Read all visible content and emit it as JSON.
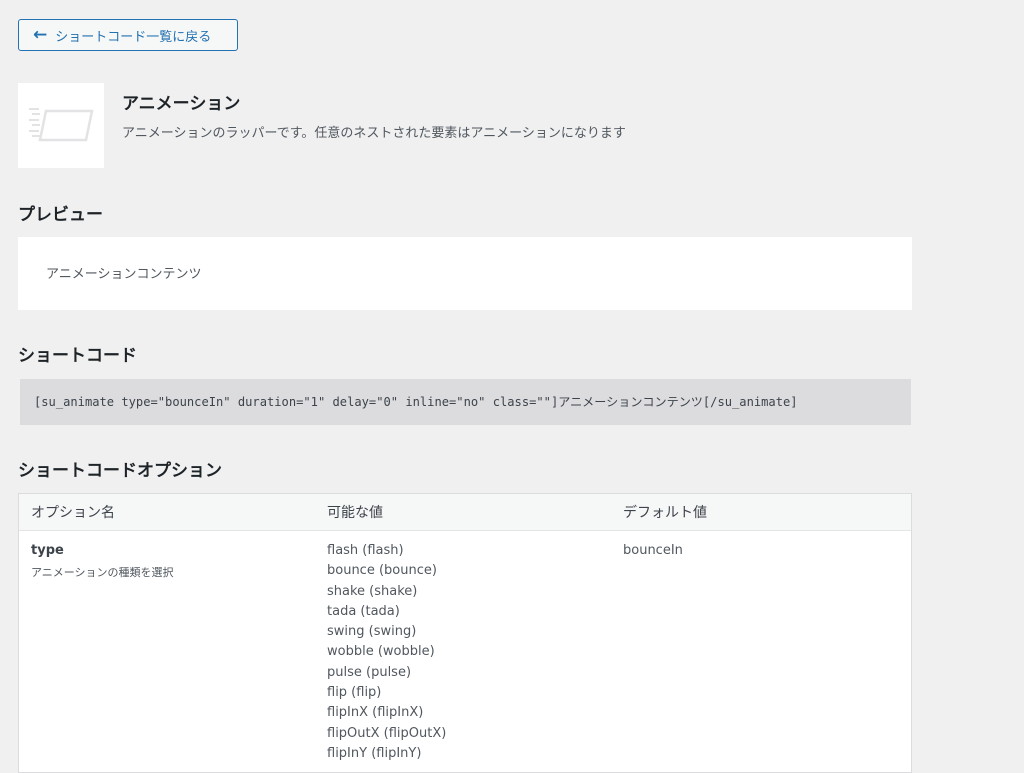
{
  "back_button": {
    "label": "ショートコード一覧に戻る",
    "icon": "arrow-left-icon",
    "color": "#2271b1"
  },
  "shortcode": {
    "title": "アニメーション",
    "description": "アニメーションのラッパーです。任意のネストされた要素はアニメーションになります",
    "icon": "animate-icon"
  },
  "preview": {
    "heading": "プレビュー",
    "content": "アニメーションコンテンツ"
  },
  "code": {
    "heading": "ショートコード",
    "text": "[su_animate type=\"bounceIn\" duration=\"1\" delay=\"0\" inline=\"no\" class=\"\"]アニメーションコンテンツ[/su_animate]"
  },
  "options": {
    "heading": "ショートコードオプション",
    "columns": [
      "オプション名",
      "可能な値",
      "デフォルト値"
    ],
    "rows": [
      {
        "name": "type",
        "description": "アニメーションの種類を選択",
        "values": [
          "flash (flash)",
          "bounce (bounce)",
          "shake (shake)",
          "tada (tada)",
          "swing (swing)",
          "wobble (wobble)",
          "pulse (pulse)",
          "flip (flip)",
          "flipInX (flipInX)",
          "flipOutX (flipOutX)",
          "flipInY (flipInY)"
        ],
        "default": "bounceIn"
      }
    ]
  }
}
